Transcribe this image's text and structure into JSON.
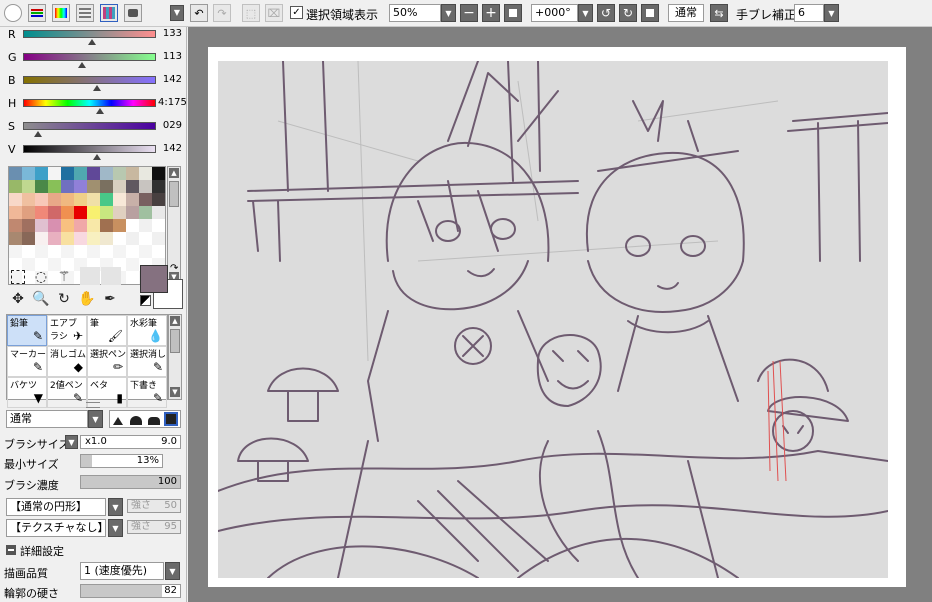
{
  "toolbar": {
    "show_selection_label": "選択領域表示",
    "zoom_value": "50%",
    "rotation_value": "+000°",
    "blend_mode_label": "通常",
    "stabilizer_label": "手ブレ補正",
    "stabilizer_value": "6",
    "show_selection_checked": true
  },
  "color_sliders": [
    {
      "label": "R",
      "value": "133",
      "level": 0.52,
      "gradient": "linear-gradient(90deg,#008e8e,#ff8e8e)"
    },
    {
      "label": "G",
      "value": "113",
      "level": 0.44,
      "gradient": "linear-gradient(90deg,#850085,#85ff8e)"
    },
    {
      "label": "B",
      "value": "142",
      "level": 0.56,
      "gradient": "linear-gradient(90deg,#857100,#8571ff)"
    },
    {
      "label": "H",
      "value": "4:175",
      "level": 0.58,
      "gradient": "linear-gradient(90deg,#ff0000,#ffff00,#00ff00,#00ffff,#0000ff,#ff00ff,#ff0000)"
    },
    {
      "label": "S",
      "value": "029",
      "level": 0.11,
      "gradient": "linear-gradient(90deg,#8e8e8e,#4a00a0)"
    },
    {
      "label": "V",
      "value": "142",
      "level": 0.56,
      "gradient": "linear-gradient(90deg,#000000,#eae0f2)"
    }
  ],
  "swatch_colors": [
    "#6a8fb0",
    "#7ab8d8",
    "#3ea0c8",
    "#f4f4f4",
    "#2070a0",
    "#50a8b0",
    "#604898",
    "#a0b8c8",
    "#b8c8b0",
    "#c8b8a0",
    "#e8e8e0",
    "#101010",
    "#98b868",
    "#c0d890",
    "#4a8848",
    "#88c058",
    "#7070c0",
    "#9080d8",
    "#a09070",
    "#7a7060",
    "#d8d0c0",
    "#605860",
    "#c8c4c0",
    "#303030",
    "#f8d8c8",
    "#f0c0a0",
    "#f8c8b8",
    "#e8a888",
    "#f0b880",
    "#f0d088",
    "#f0e0a8",
    "#48c888",
    "#f8e8d8",
    "#c8b0a8",
    "#786060",
    "#484040",
    "#f0b898",
    "#e0a080",
    "#f08878",
    "#d06868",
    "#f09050",
    "#e80000",
    "#f8f070",
    "#c8e880",
    "#e0d0c0",
    "#b8a0a0",
    "#a0c0a0",
    "#e8e8e8",
    "#c08870",
    "#a07060",
    "#e0c0d0",
    "#d890b0",
    "#f8c080",
    "#f0a8a8",
    "#f8e8a8",
    "#a07050",
    "#c89060",
    "#ffffff",
    "#f0f0f0",
    "#ffffff",
    "#a88870",
    "#886858",
    "#f8f0f0",
    "#e8b0c0",
    "#f8e0a0",
    "#f8d8e0",
    "#f8f0c0",
    "#f0e8d0",
    "#ffffff",
    "#f0f0f0",
    "#ffffff",
    "#f0f0f0"
  ],
  "current_color": "#857180",
  "brushes": [
    {
      "name": "鉛筆",
      "icon": "✎",
      "selected": true
    },
    {
      "name": "エアブラシ",
      "icon": "✈"
    },
    {
      "name": "筆",
      "icon": "🖌"
    },
    {
      "name": "水彩筆",
      "icon": "💧"
    },
    {
      "name": "マーカー",
      "icon": "✎"
    },
    {
      "name": "消しゴム",
      "icon": "◆"
    },
    {
      "name": "選択ペン",
      "icon": "✏"
    },
    {
      "name": "選択消し",
      "icon": "✎"
    },
    {
      "name": "バケツ",
      "icon": "▼"
    },
    {
      "name": "2値ペン",
      "icon": "✎"
    },
    {
      "name": "ベタ",
      "icon": "▮"
    },
    {
      "name": "下書き",
      "icon": "✎"
    }
  ],
  "brush_props": {
    "mode": "通常",
    "brush_size_label": "ブラシサイズ",
    "brush_size_mult": "x1.0",
    "brush_size_value": "9.0",
    "min_size_label": "最小サイズ",
    "min_size_value": "13%",
    "min_size_level": 0.13,
    "density_label": "ブラシ濃度",
    "density_value": "100",
    "density_level": 1.0,
    "shape": "【通常の円形】",
    "shape_strength_label": "強さ",
    "shape_strength_value": "50",
    "texture": "【テクスチャなし】",
    "texture_strength_label": "強さ",
    "texture_strength_value": "95",
    "advanced_label": "詳細設定",
    "quality_label": "描画品質",
    "quality_value": "1 (速度優先)",
    "edge_label": "輪郭の硬さ",
    "edge_value": "82",
    "edge_level": 0.82
  }
}
